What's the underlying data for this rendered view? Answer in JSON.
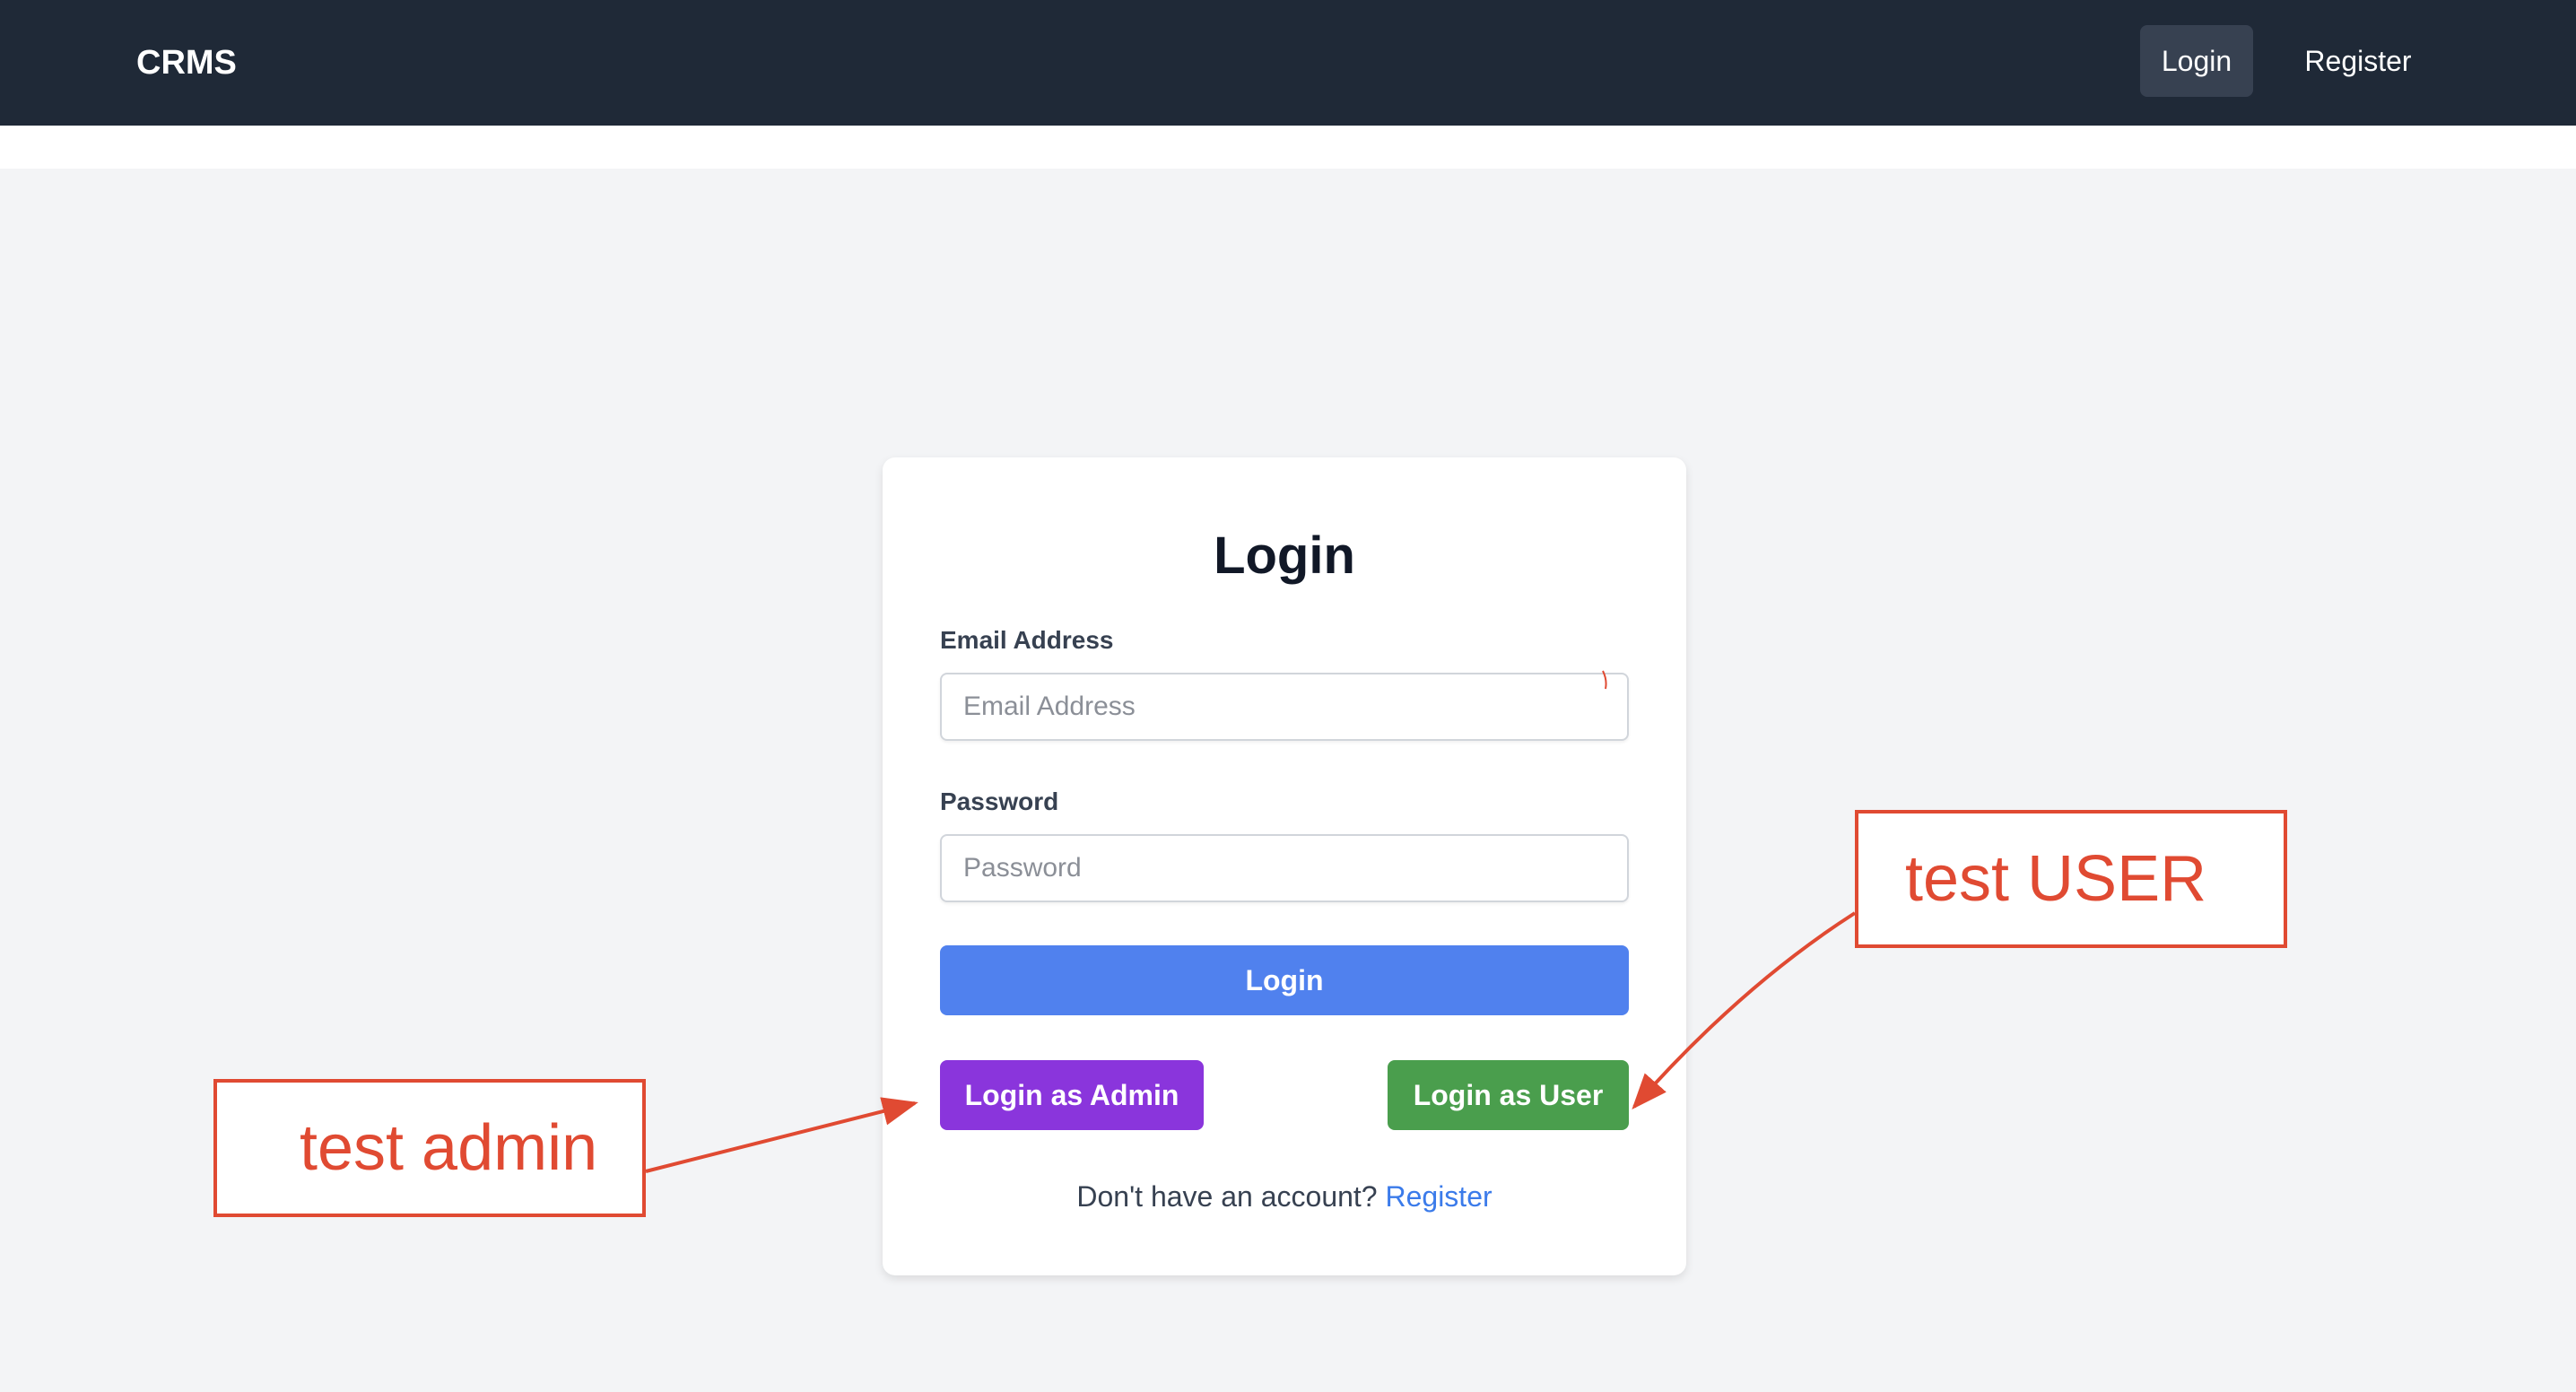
{
  "navbar": {
    "brand": "CRMS",
    "login_label": "Login",
    "register_label": "Register"
  },
  "login_card": {
    "title": "Login",
    "email_label": "Email Address",
    "email_placeholder": "Email Address",
    "email_value": "",
    "password_label": "Password",
    "password_placeholder": "Password",
    "password_value": "",
    "login_button": "Login",
    "admin_button": "Login as Admin",
    "user_button": "Login as User",
    "footer_text": "Don't have an account?",
    "footer_link": "Register"
  },
  "annotations": {
    "admin_note": "test admin",
    "user_note": "test USER",
    "color": "#e04a32"
  },
  "colors": {
    "navbar": "#1f2937",
    "page_background": "#f3f4f6",
    "login_button": "#5081ee",
    "admin_button": "#8a35dc",
    "user_button": "#4a9e4d",
    "link": "#3b7bea"
  }
}
